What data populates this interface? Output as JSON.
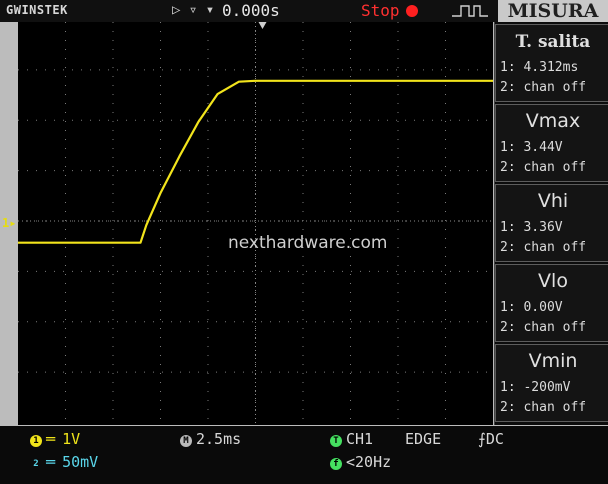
{
  "header": {
    "brand": "GWINSTEK",
    "trigger_mode_icons": "▷ ▿ ▾",
    "delay": "0.000s",
    "run_state": "Stop",
    "measure_title": "MISURA"
  },
  "side_panels": [
    {
      "title": "T. salita",
      "ch1": "1: 4.312ms",
      "ch2": "2: chan off"
    },
    {
      "title": "Vmax",
      "ch1": "1: 3.44V",
      "ch2": "2: chan off"
    },
    {
      "title": "Vhi",
      "ch1": "1: 3.36V",
      "ch2": "2: chan off"
    },
    {
      "title": "Vlo",
      "ch1": "1: 0.00V",
      "ch2": "2: chan off"
    },
    {
      "title": "Vmin",
      "ch1": "1: -200mV",
      "ch2": "2: chan off"
    }
  ],
  "waveform": {
    "channel": "1",
    "x_unit_per_div": "2.5ms",
    "trace_color": "#f2e41c",
    "low_level_div": -0.08,
    "high_level_div": 3.44,
    "points_div": [
      [
        -5.0,
        -0.08
      ],
      [
        -2.42,
        -0.08
      ],
      [
        -2.3,
        0.3
      ],
      [
        -2.0,
        1.0
      ],
      [
        -1.6,
        1.8
      ],
      [
        -1.2,
        2.55
      ],
      [
        -0.8,
        3.15
      ],
      [
        -0.35,
        3.42
      ],
      [
        0.0,
        3.44
      ],
      [
        5.0,
        3.44
      ]
    ]
  },
  "watermark": "nexthardware.com",
  "marker_label": "1",
  "footer": {
    "ch1_badge": "1",
    "ch1_scale": "1V",
    "ch2_badge": "2",
    "ch2_scale": "50mV",
    "time_badge": "M",
    "timebase": "2.5ms",
    "trig_badge": "T",
    "trig_source": "CH1",
    "trig_type": "EDGE",
    "trig_coupling": "DC",
    "freq_badge": "f",
    "frequency": "<20Hz"
  },
  "colors": {
    "ch1": "#f0e41a",
    "ch2": "#5ad6ea",
    "trigger": "#45e060",
    "stop": "#ff3030"
  }
}
